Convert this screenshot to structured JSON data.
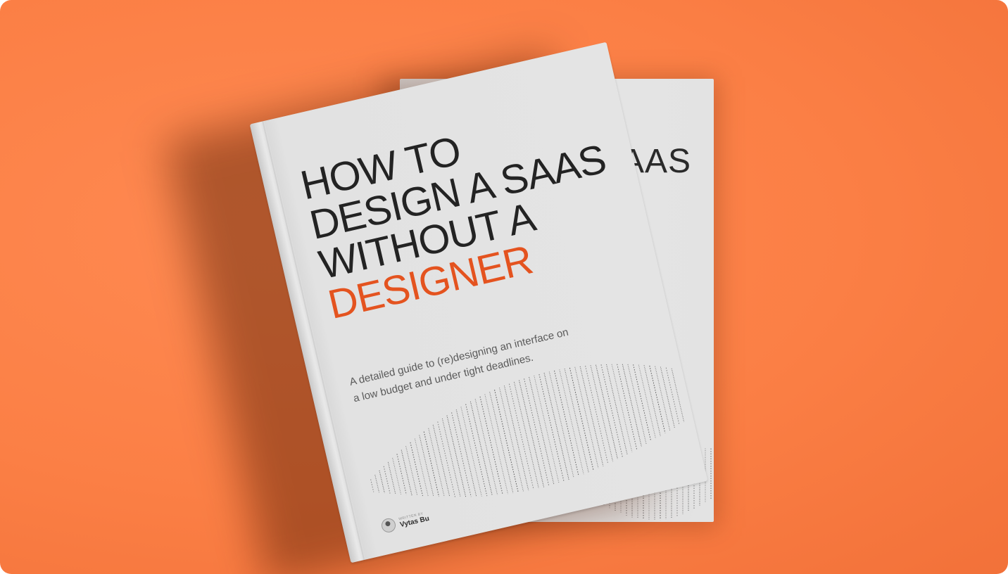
{
  "cover": {
    "title_lines": [
      "HOW TO",
      "DESIGN A SAAS",
      "WITHOUT A"
    ],
    "title_accent": "DESIGNER",
    "subtitle": "A detailed guide to (re)designing an interface on a low budget and under tight deadlines.",
    "written_by": "WRITTEN BY",
    "author": "Vytas Bu"
  },
  "back_cover": {
    "visible_text": "SAAS"
  },
  "colors": {
    "background": "#fb7f45",
    "accent": "#e4531f",
    "cover": "#e4e4e4",
    "ink": "#232323"
  }
}
